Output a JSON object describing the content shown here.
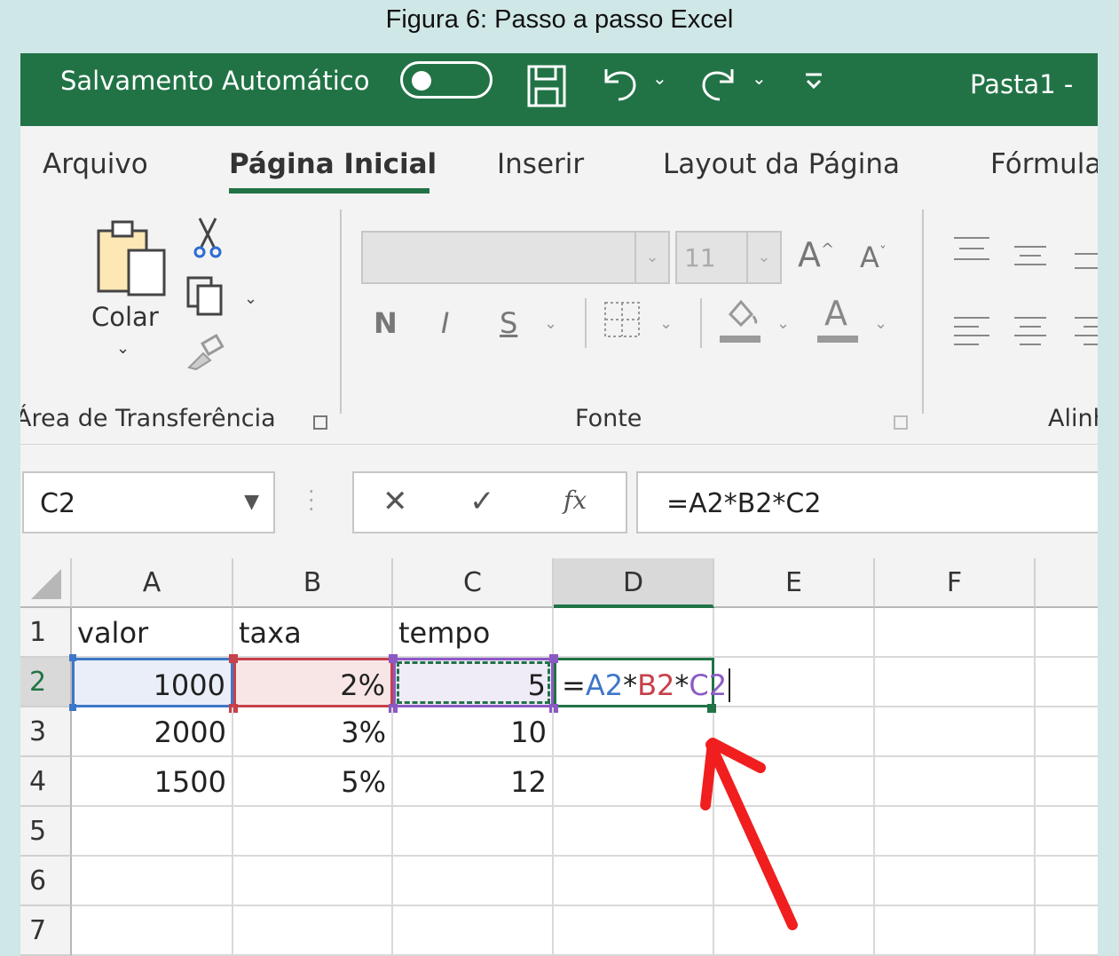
{
  "caption": "Figura 6: Passo a passo Excel",
  "titlebar": {
    "autosave_label": "Salvamento Automático",
    "document_title": "Pasta1  -"
  },
  "tabs": [
    "Arquivo",
    "Página Inicial",
    "Inserir",
    "Layout da Página",
    "Fórmulas"
  ],
  "active_tab": "Página Inicial",
  "ribbon": {
    "clipboard": {
      "paste_label": "Colar",
      "group_label": "Área de Transferência"
    },
    "font": {
      "size_value": "11",
      "group_label": "Fonte",
      "bold": "N",
      "italic": "I",
      "underline": "S",
      "grow": "A",
      "shrink": "A",
      "font_color": "A"
    },
    "alignment": {
      "group_label": "Alinhamento"
    }
  },
  "formula_bar": {
    "name_box": "C2",
    "fx": "fx",
    "formula": "=A2*B2*C2"
  },
  "sheet": {
    "columns": [
      "A",
      "B",
      "C",
      "D",
      "E",
      "F"
    ],
    "rows": [
      "1",
      "2",
      "3",
      "4",
      "5",
      "6",
      "7"
    ],
    "cells": {
      "A1": "valor",
      "B1": "taxa",
      "C1": "tempo",
      "A2": "1000",
      "B2": "2%",
      "C2": "5",
      "A3": "2000",
      "B3": "3%",
      "C3": "10",
      "A4": "1500",
      "B4": "5%",
      "C4": "12"
    },
    "editing_formula": {
      "eq": "=",
      "a": "A2",
      "star1": "*",
      "b": "B2",
      "star2": "*",
      "c": "C2"
    }
  },
  "colors": {
    "excel_green": "#217346",
    "ref_blue": "#3e77c8",
    "ref_red": "#c7404a",
    "ref_purple": "#8c59c4",
    "arrow_red": "#f01e1e"
  }
}
